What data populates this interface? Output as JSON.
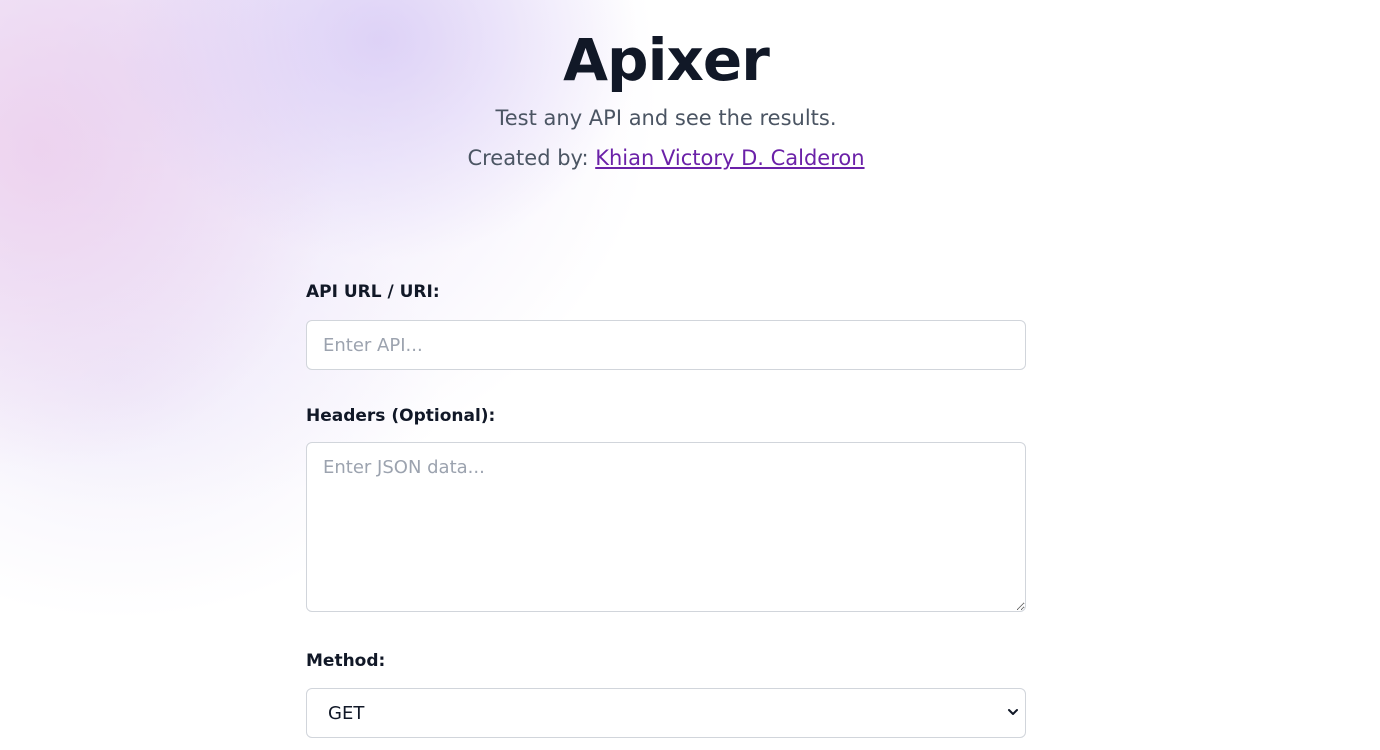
{
  "header": {
    "title": "Apixer",
    "subtitle": "Test any API and see the results.",
    "credits_prefix": "Created by: ",
    "author_link": "Khian Victory D. Calderon"
  },
  "form": {
    "api_url": {
      "label": "API URL / URI:",
      "value": "",
      "placeholder": "Enter API..."
    },
    "headers": {
      "label": "Headers (Optional):",
      "value": "",
      "placeholder": "Enter JSON data..."
    },
    "method": {
      "label": "Method:",
      "selected": "GET",
      "icon": "chevron-down-icon"
    }
  },
  "colors": {
    "link": "#6b21a8",
    "title": "#111827",
    "muted_text": "#4b5563",
    "border": "#d1d5db",
    "placeholder": "#9ca3af"
  }
}
